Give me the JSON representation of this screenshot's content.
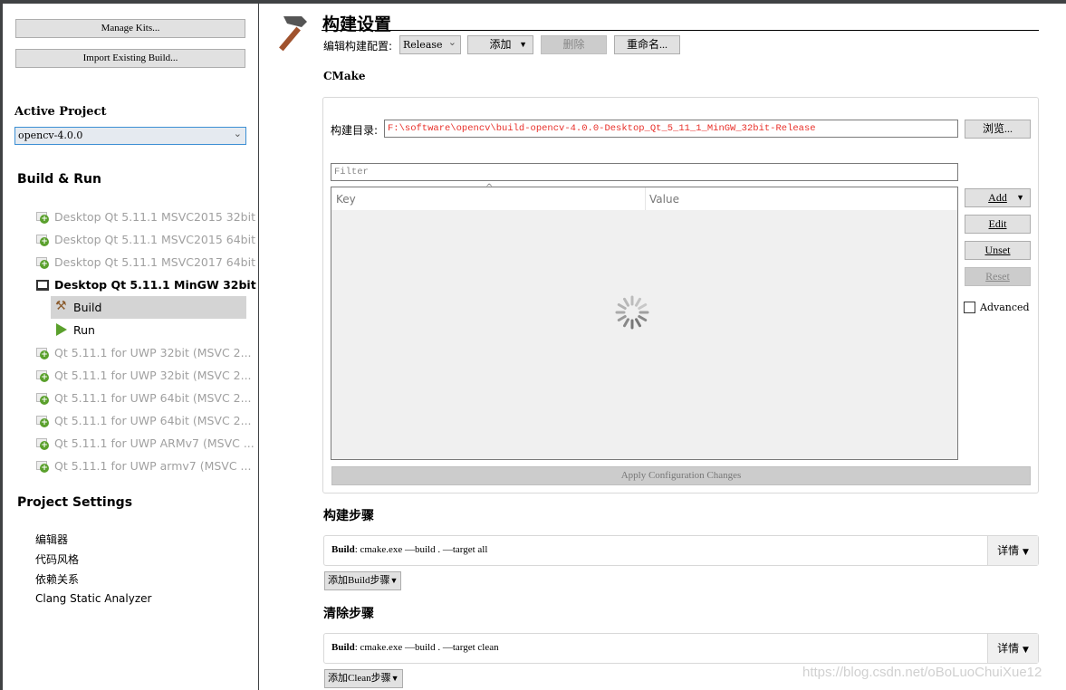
{
  "sidebar": {
    "manage_kits": "Manage Kits...",
    "import_build": "Import Existing Build...",
    "active_project_label": "Active Project",
    "active_project_value": "opencv-4.0.0",
    "build_run_label": "Build & Run",
    "kits": [
      {
        "label": "Desktop Qt 5.11.1 MSVC2015 32bit",
        "state": "disabled"
      },
      {
        "label": "Desktop Qt 5.11.1 MSVC2015 64bit",
        "state": "disabled"
      },
      {
        "label": "Desktop Qt 5.11.1 MSVC2017 64bit",
        "state": "disabled"
      },
      {
        "label": "Desktop Qt 5.11.1 MinGW 32bit",
        "state": "active"
      },
      {
        "label": "Qt 5.11.1 for UWP 32bit (MSVC 2...",
        "state": "disabled"
      },
      {
        "label": "Qt 5.11.1 for UWP 32bit (MSVC 2...",
        "state": "disabled"
      },
      {
        "label": "Qt 5.11.1 for UWP 64bit (MSVC 2...",
        "state": "disabled"
      },
      {
        "label": "Qt 5.11.1 for UWP 64bit (MSVC 2...",
        "state": "disabled"
      },
      {
        "label": "Qt 5.11.1 for UWP ARMv7 (MSVC ...",
        "state": "disabled"
      },
      {
        "label": "Qt 5.11.1 for UWP armv7 (MSVC ...",
        "state": "disabled"
      }
    ],
    "build_item": "Build",
    "run_item": "Run",
    "project_settings_label": "Project Settings",
    "settings": [
      "编辑器",
      "代码风格",
      "依赖关系",
      "Clang Static Analyzer"
    ]
  },
  "main": {
    "title": "构建设置",
    "edit_config_label": "编辑构建配置:",
    "config_value": "Release",
    "add_label": "添加",
    "delete_label": "删除",
    "rename_label": "重命名...",
    "cmake_label": "CMake",
    "build_dir_label": "构建目录:",
    "build_dir_value": "F:\\software\\opencv\\build-opencv-4.0.0-Desktop_Qt_5_11_1_MinGW_32bit-Release",
    "browse_label": "浏览...",
    "filter_placeholder": "Filter",
    "col_key": "Key",
    "col_value": "Value",
    "add_btn": "Add",
    "edit_btn": "Edit",
    "unset_btn": "Unset",
    "reset_btn": "Reset",
    "advanced_label": "Advanced",
    "advanced_checked": false,
    "apply_label": "Apply Configuration Changes",
    "build_steps_label": "构建步骤",
    "build_step_prefix": "Build",
    "build_step_cmd": ": cmake.exe —build . —target all",
    "details_label": "详情",
    "add_build_step": "添加Build步骤",
    "clean_steps_label": "清除步骤",
    "clean_step_prefix": "Build",
    "clean_step_cmd": ": cmake.exe —build . —target clean",
    "add_clean_step": "添加Clean步骤"
  },
  "watermark": "https://blog.csdn.net/oBoLuoChuiXue12",
  "colors": {
    "build_dir_text": "#e8302a",
    "selected_item": "#d4d4d4",
    "run_green": "#5aa02c"
  }
}
